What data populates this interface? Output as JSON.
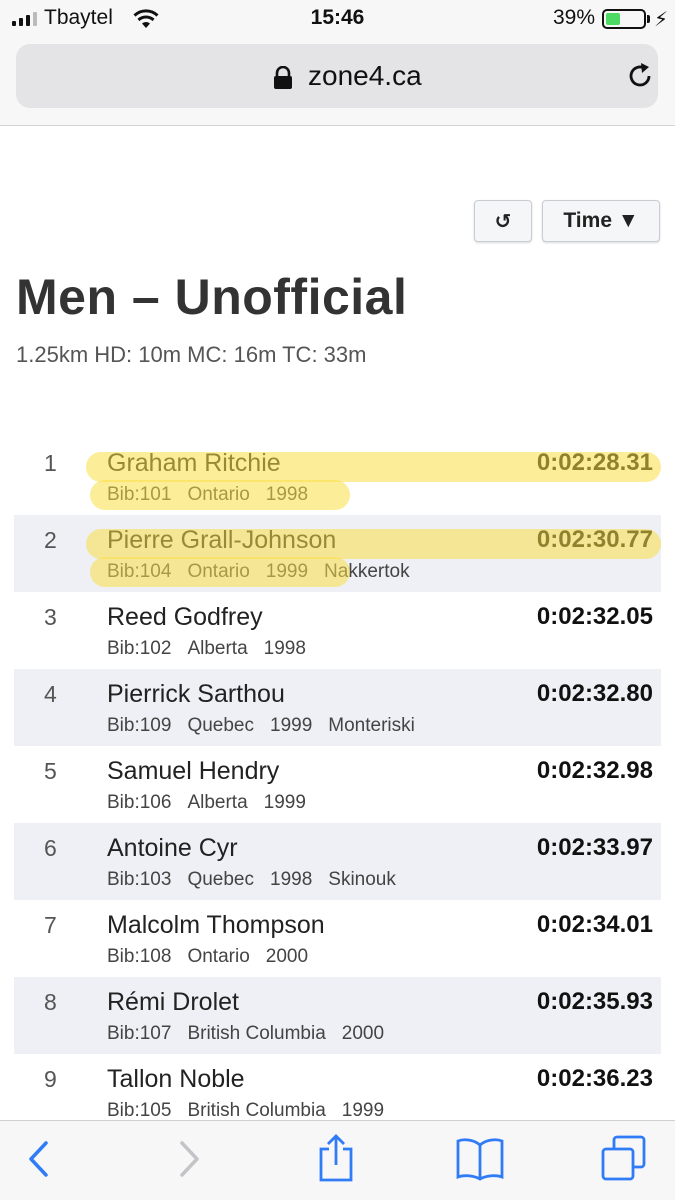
{
  "status_bar": {
    "carrier": "Tbaytel",
    "time": "15:46",
    "battery_percent": "39%",
    "battery_level": 0.39
  },
  "browser": {
    "url": "zone4.ca"
  },
  "controls": {
    "refresh_label": "↺",
    "sort_label": "Time ▼"
  },
  "page": {
    "title": "Men – Unofficial",
    "subtitle": "1.25km HD: 10m MC: 16m TC: 33m"
  },
  "results": [
    {
      "rank": "1",
      "name": "Graham Ritchie",
      "bib": "Bib:101",
      "province": "Ontario",
      "year": "1998",
      "club": "",
      "time": "0:02:28.31",
      "highlighted": true
    },
    {
      "rank": "2",
      "name": "Pierre Grall-Johnson",
      "bib": "Bib:104",
      "province": "Ontario",
      "year": "1999",
      "club": "Nakkertok",
      "time": "0:02:30.77",
      "highlighted": true
    },
    {
      "rank": "3",
      "name": "Reed Godfrey",
      "bib": "Bib:102",
      "province": "Alberta",
      "year": "1998",
      "club": "",
      "time": "0:02:32.05",
      "highlighted": false
    },
    {
      "rank": "4",
      "name": "Pierrick Sarthou",
      "bib": "Bib:109",
      "province": "Quebec",
      "year": "1999",
      "club": "Monteriski",
      "time": "0:02:32.80",
      "highlighted": false
    },
    {
      "rank": "5",
      "name": "Samuel Hendry",
      "bib": "Bib:106",
      "province": "Alberta",
      "year": "1999",
      "club": "",
      "time": "0:02:32.98",
      "highlighted": false
    },
    {
      "rank": "6",
      "name": "Antoine Cyr",
      "bib": "Bib:103",
      "province": "Quebec",
      "year": "1998",
      "club": "Skinouk",
      "time": "0:02:33.97",
      "highlighted": false
    },
    {
      "rank": "7",
      "name": "Malcolm Thompson",
      "bib": "Bib:108",
      "province": "Ontario",
      "year": "2000",
      "club": "",
      "time": "0:02:34.01",
      "highlighted": false
    },
    {
      "rank": "8",
      "name": "Rémi Drolet",
      "bib": "Bib:107",
      "province": "British Columbia",
      "year": "2000",
      "club": "",
      "time": "0:02:35.93",
      "highlighted": false
    },
    {
      "rank": "9",
      "name": "Tallon Noble",
      "bib": "Bib:105",
      "province": "British Columbia",
      "year": "1999",
      "club": "",
      "time": "0:02:36.23",
      "highlighted": false
    }
  ],
  "toolbar": {
    "icons": [
      "back-icon",
      "forward-icon",
      "share-icon",
      "bookmarks-icon",
      "tabs-icon"
    ]
  }
}
